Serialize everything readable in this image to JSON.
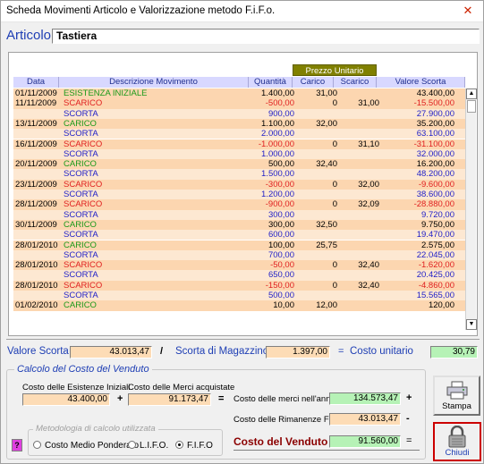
{
  "window": {
    "title": "Scheda Movimenti Articolo e Valorizzazione metodo F.i.F.o.",
    "close_glyph": "✕"
  },
  "articolo": {
    "label": "Articolo",
    "value": "Tastiera"
  },
  "grid": {
    "group_header": "Prezzo Unitario",
    "columns": [
      "Data",
      "Descrizione Movimento",
      "Quantità",
      "Carico",
      "Scarico",
      "Valore Scorta"
    ],
    "rows": [
      {
        "type": "mov",
        "kind": "esist",
        "data": "01/11/2009",
        "desc": "ESISTENZA INIZIALE",
        "qta": "1.400,00",
        "carico": "31,00",
        "scarico": "",
        "valore": "43.400,00"
      },
      {
        "type": "mov",
        "kind": "scarico",
        "data": "11/11/2009",
        "desc": "SCARICO",
        "qta": "-500,00",
        "carico": "0",
        "scarico": "31,00",
        "valore": "-15.500,00"
      },
      {
        "type": "scorta",
        "kind": "scorta",
        "data": "",
        "desc": "SCORTA",
        "qta": "900,00",
        "carico": "",
        "scarico": "",
        "valore": "27.900,00"
      },
      {
        "type": "mov",
        "kind": "carico",
        "data": "13/11/2009",
        "desc": "CARICO",
        "qta": "1.100,00",
        "carico": "32,00",
        "scarico": "",
        "valore": "35.200,00"
      },
      {
        "type": "scorta",
        "kind": "scorta",
        "data": "",
        "desc": "SCORTA",
        "qta": "2.000,00",
        "carico": "",
        "scarico": "",
        "valore": "63.100,00"
      },
      {
        "type": "mov",
        "kind": "scarico",
        "data": "16/11/2009",
        "desc": "SCARICO",
        "qta": "-1.000,00",
        "carico": "0",
        "scarico": "31,10",
        "valore": "-31.100,00"
      },
      {
        "type": "scorta",
        "kind": "scorta",
        "data": "",
        "desc": "SCORTA",
        "qta": "1.000,00",
        "carico": "",
        "scarico": "",
        "valore": "32.000,00"
      },
      {
        "type": "mov",
        "kind": "carico",
        "data": "20/11/2009",
        "desc": "CARICO",
        "qta": "500,00",
        "carico": "32,40",
        "scarico": "",
        "valore": "16.200,00"
      },
      {
        "type": "scorta",
        "kind": "scorta",
        "data": "",
        "desc": "SCORTA",
        "qta": "1.500,00",
        "carico": "",
        "scarico": "",
        "valore": "48.200,00"
      },
      {
        "type": "mov",
        "kind": "scarico",
        "data": "23/11/2009",
        "desc": "SCARICO",
        "qta": "-300,00",
        "carico": "0",
        "scarico": "32,00",
        "valore": "-9.600,00"
      },
      {
        "type": "scorta",
        "kind": "scorta",
        "data": "",
        "desc": "SCORTA",
        "qta": "1.200,00",
        "carico": "",
        "scarico": "",
        "valore": "38.600,00"
      },
      {
        "type": "mov",
        "kind": "scarico",
        "data": "28/11/2009",
        "desc": "SCARICO",
        "qta": "-900,00",
        "carico": "0",
        "scarico": "32,09",
        "valore": "-28.880,00"
      },
      {
        "type": "scorta",
        "kind": "scorta",
        "data": "",
        "desc": "SCORTA",
        "qta": "300,00",
        "carico": "",
        "scarico": "",
        "valore": "9.720,00"
      },
      {
        "type": "mov",
        "kind": "carico",
        "data": "30/11/2009",
        "desc": "CARICO",
        "qta": "300,00",
        "carico": "32,50",
        "scarico": "",
        "valore": "9.750,00"
      },
      {
        "type": "scorta",
        "kind": "scorta",
        "data": "",
        "desc": "SCORTA",
        "qta": "600,00",
        "carico": "",
        "scarico": "",
        "valore": "19.470,00"
      },
      {
        "type": "mov",
        "kind": "carico",
        "data": "28/01/2010",
        "desc": "CARICO",
        "qta": "100,00",
        "carico": "25,75",
        "scarico": "",
        "valore": "2.575,00"
      },
      {
        "type": "scorta",
        "kind": "scorta",
        "data": "",
        "desc": "SCORTA",
        "qta": "700,00",
        "carico": "",
        "scarico": "",
        "valore": "22.045,00"
      },
      {
        "type": "mov",
        "kind": "scarico",
        "data": "28/01/2010",
        "desc": "SCARICO",
        "qta": "-50,00",
        "carico": "0",
        "scarico": "32,40",
        "valore": "-1.620,00"
      },
      {
        "type": "scorta",
        "kind": "scorta",
        "data": "",
        "desc": "SCORTA",
        "qta": "650,00",
        "carico": "",
        "scarico": "",
        "valore": "20.425,00"
      },
      {
        "type": "mov",
        "kind": "scarico",
        "data": "28/01/2010",
        "desc": "SCARICO",
        "qta": "-150,00",
        "carico": "0",
        "scarico": "32,40",
        "valore": "-4.860,00"
      },
      {
        "type": "scorta",
        "kind": "scorta",
        "data": "",
        "desc": "SCORTA",
        "qta": "500,00",
        "carico": "",
        "scarico": "",
        "valore": "15.565,00"
      },
      {
        "type": "mov",
        "kind": "carico",
        "data": "01/02/2010",
        "desc": "CARICO",
        "qta": "10,00",
        "carico": "12,00",
        "scarico": "",
        "valore": "120,00"
      }
    ]
  },
  "summary": {
    "valore_scorta_label": "Valore Scorta",
    "valore_scorta": "43.013,47",
    "slash": "/",
    "scorta_magazzino_label": "Scorta di Magazzino",
    "scorta_magazzino": "1.397,00",
    "eq": "=",
    "costo_unitario_label": "Costo unitario",
    "costo_unitario": "30,79"
  },
  "cdv": {
    "group_title": "Calcolo del Costo del Venduto",
    "esistenze_label": "Costo delle Esistenze Iniziali",
    "esistenze": "43.400,00",
    "plus": "+",
    "acquistate_label": "Costo delle Merci acquistate",
    "acquistate": "91.173,47",
    "eq": "=",
    "merci_anno_label": "Costo delle merci nell'anno",
    "merci_anno": "134.573,47",
    "rimanenze_label": "Costo delle Rimanenze Finali",
    "rimanenze": "43.013,47",
    "minus": "-",
    "venduto_label": "Costo del Venduto",
    "venduto": "91.560,00",
    "metodologia_title": "Metodologia di calcolo utilizzata",
    "options": [
      "Costo Medio Ponderato",
      "L.I.F.O.",
      "F.I.F.O"
    ],
    "selected": "F.I.F.O",
    "help": "?"
  },
  "buttons": {
    "stampa": "Stampa",
    "chiudi": "Chiudi"
  }
}
